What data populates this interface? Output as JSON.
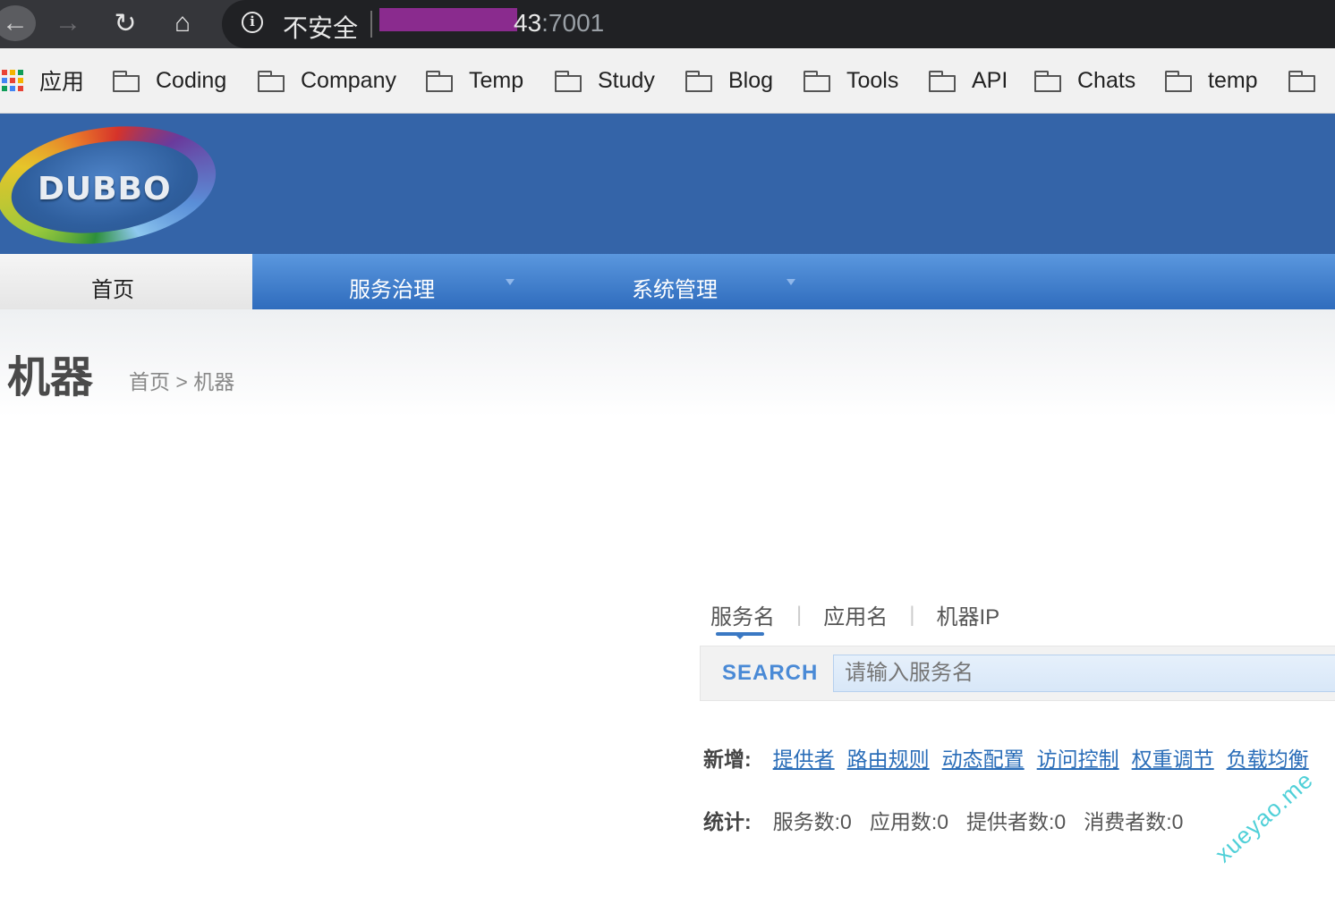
{
  "browser": {
    "security_label": "不安全",
    "url_visible": "43",
    "url_port": ":7001",
    "bookmarks": [
      {
        "label": "应用",
        "icon": "apps-grid-icon"
      },
      {
        "label": "Coding",
        "icon": "folder-icon"
      },
      {
        "label": "Company",
        "icon": "folder-icon"
      },
      {
        "label": "Temp",
        "icon": "folder-icon"
      },
      {
        "label": "Study",
        "icon": "folder-icon"
      },
      {
        "label": "Blog",
        "icon": "folder-icon"
      },
      {
        "label": "Tools",
        "icon": "folder-icon"
      },
      {
        "label": "API",
        "icon": "folder-icon"
      },
      {
        "label": "Chats",
        "icon": "folder-icon"
      },
      {
        "label": "temp",
        "icon": "folder-icon"
      }
    ]
  },
  "header": {
    "logo_text": "DUBBO"
  },
  "nav": {
    "home": "首页",
    "items": [
      {
        "label": "服务治理"
      },
      {
        "label": "系统管理"
      }
    ]
  },
  "page": {
    "title": "机器",
    "breadcrumb": "首页 > 机器"
  },
  "search": {
    "tabs": [
      "服务名",
      "应用名",
      "机器IP"
    ],
    "button": "SEARCH",
    "placeholder": "请输入服务名"
  },
  "create": {
    "label": "新增:",
    "links": [
      "提供者",
      "路由规则",
      "动态配置",
      "访问控制",
      "权重调节",
      "负载均衡"
    ]
  },
  "stats": {
    "label": "统计:",
    "items": [
      "服务数:0",
      "应用数:0",
      "提供者数:0",
      "消费者数:0"
    ]
  },
  "watermark": "xueyao.me",
  "colors": {
    "header_blue": "#3464a8",
    "nav_blue": "#2f6cbd",
    "link_blue": "#2a6db8",
    "accent": "#3a78c3"
  }
}
